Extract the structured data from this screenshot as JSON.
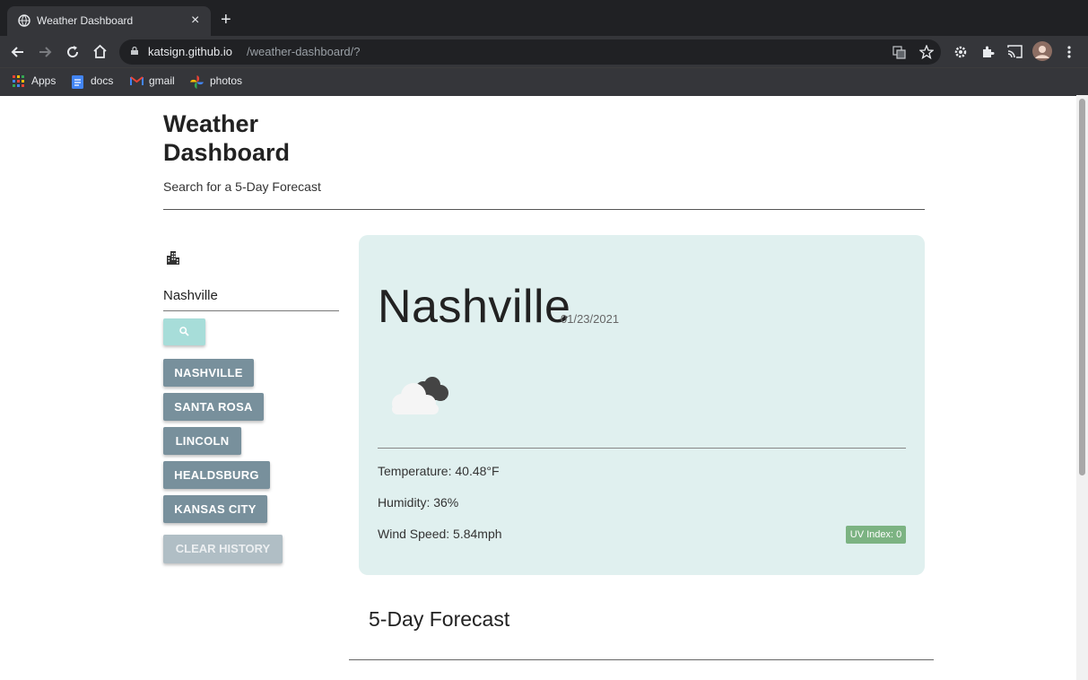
{
  "browser": {
    "tab_title": "Weather Dashboard",
    "tab_close": "×",
    "new_tab": "+",
    "url_host": "katsign.github.io",
    "url_path": "/weather-dashboard/?",
    "bookmarks": [
      "Apps",
      "docs",
      "gmail",
      "photos"
    ]
  },
  "header": {
    "title": "Weather Dashboard",
    "subtitle": "Search for a 5-Day Forecast"
  },
  "search": {
    "value": "Nashville"
  },
  "history": [
    "NASHVILLE",
    "SANTA ROSA",
    "LINCOLN",
    "HEALDSBURG",
    "KANSAS CITY"
  ],
  "clear_label": "CLEAR HISTORY",
  "current": {
    "city": "Nashville",
    "date": "01/23/2021",
    "temperature": "Temperature: 40.48°F",
    "humidity": "Humidity: 36%",
    "wind": "Wind Speed: 5.84mph",
    "uv": "UV Index: 0",
    "uv_color": "#7cb382",
    "icon": "broken-clouds-icon"
  },
  "forecast_title": "5-Day Forecast",
  "colors": {
    "card_bg": "#e0f0ef",
    "history_button": "#78909c",
    "search_button": "#a7ddd9",
    "clear_button": "#b0bec5"
  }
}
